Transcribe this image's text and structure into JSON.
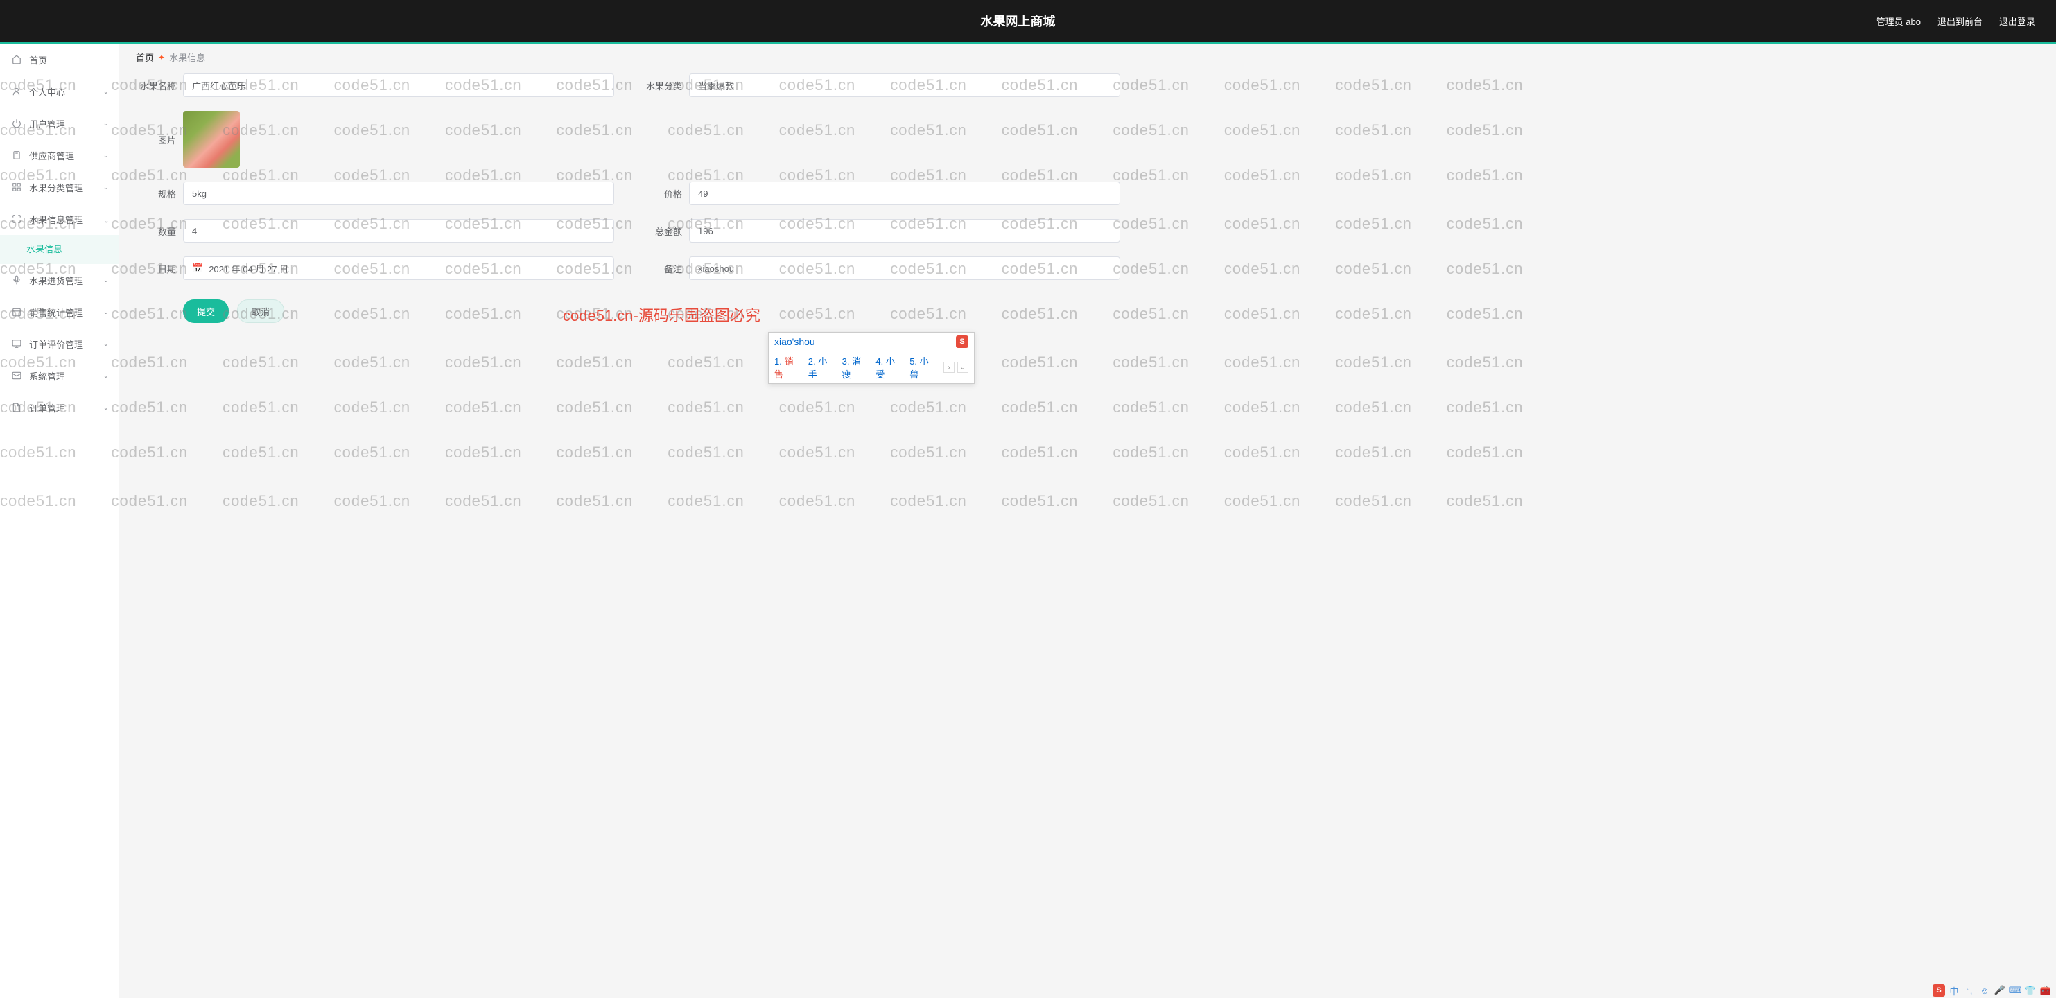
{
  "header": {
    "title": "水果网上商城",
    "admin_label": "管理员 abo",
    "front_link": "退出到前台",
    "logout_link": "退出登录"
  },
  "sidebar": {
    "items": [
      {
        "label": "首页",
        "icon": "home"
      },
      {
        "label": "个人中心",
        "icon": "user"
      },
      {
        "label": "用户管理",
        "icon": "power"
      },
      {
        "label": "供应商管理",
        "icon": "clipboard"
      },
      {
        "label": "水果分类管理",
        "icon": "grid"
      },
      {
        "label": "水果信息管理",
        "icon": "expand",
        "expanded": true
      },
      {
        "label": "水果进货管理",
        "icon": "mic"
      },
      {
        "label": "销售统计管理",
        "icon": "calendar"
      },
      {
        "label": "订单评价管理",
        "icon": "monitor"
      },
      {
        "label": "系统管理",
        "icon": "mail"
      },
      {
        "label": "订单管理",
        "icon": "file"
      }
    ],
    "submenu_active": "水果信息"
  },
  "breadcrumb": {
    "home": "首页",
    "current": "水果信息"
  },
  "form": {
    "name_label": "水果名称",
    "name_value": "广西红心芭乐",
    "category_label": "水果分类",
    "category_value": "当季爆款",
    "image_label": "图片",
    "spec_label": "规格",
    "spec_value": "5kg",
    "price_label": "价格",
    "price_value": "49",
    "qty_label": "数量",
    "qty_value": "4",
    "total_label": "总金额",
    "total_value": "196",
    "date_label": "日期",
    "date_value": "2021 年 04 月 27 日",
    "remark_label": "备注",
    "remark_value": "xiaoshou",
    "submit": "提交",
    "cancel": "取消"
  },
  "ime": {
    "pinyin": "xiao'shou",
    "candidates": [
      {
        "num": "1.",
        "text": "销售"
      },
      {
        "num": "2.",
        "text": "小手"
      },
      {
        "num": "3.",
        "text": "消瘦"
      },
      {
        "num": "4.",
        "text": "小受"
      },
      {
        "num": "5.",
        "text": "小兽"
      }
    ]
  },
  "watermark": {
    "text": "code51.cn",
    "center_text": "code51.cn-源码乐园盗图必究"
  },
  "taskbar": {
    "ime_mode": "中"
  }
}
